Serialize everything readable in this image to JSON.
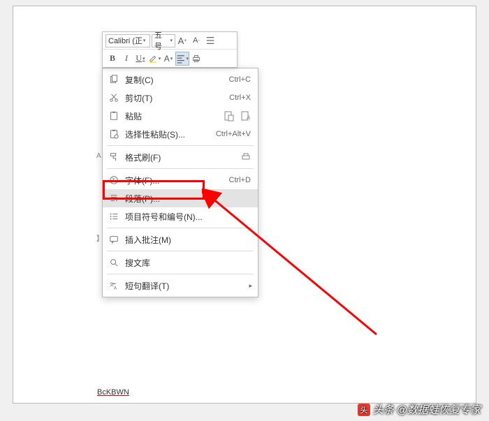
{
  "toolbar": {
    "font_name": "Calibri (正",
    "font_size": "五号",
    "bold": "B",
    "italic": "I"
  },
  "menu": {
    "copy": {
      "label": "复制(C)",
      "shortcut": "Ctrl+C"
    },
    "cut": {
      "label": "剪切(T)",
      "shortcut": "Ctrl+X"
    },
    "paste": {
      "label": "粘贴"
    },
    "paste_special": {
      "label": "选择性粘贴(S)...",
      "shortcut": "Ctrl+Alt+V"
    },
    "format_painter": {
      "label": "格式刷(F)"
    },
    "font": {
      "label": "字体(F)...",
      "shortcut": "Ctrl+D"
    },
    "paragraph": {
      "label": "段落(P)..."
    },
    "bullets": {
      "label": "项目符号和编号(N)..."
    },
    "comment": {
      "label": "插入批注(M)"
    },
    "search_lib": {
      "label": "搜文库"
    },
    "translate": {
      "label": "短句翻译(T)"
    }
  },
  "footer": {
    "text": "BcKBWN"
  },
  "watermark": {
    "prefix": "头条",
    "author": "@数据蛙恢复专家"
  },
  "colors": {
    "highlight_red": "#ff0000"
  }
}
